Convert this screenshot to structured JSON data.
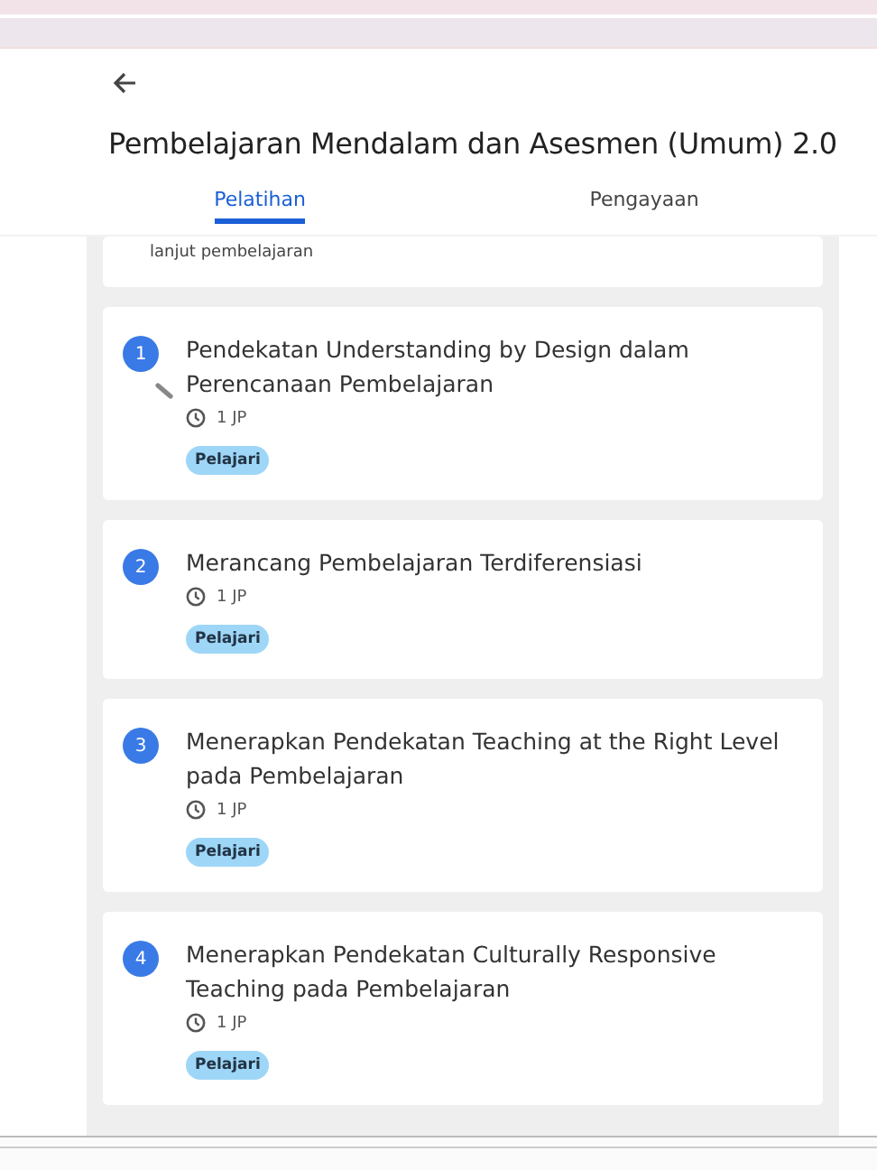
{
  "header": {
    "title": "Pembelajaran Mendalam dan Asesmen (Umum) 2.0"
  },
  "tabs": [
    {
      "label": "Pelatihan",
      "selected": true
    },
    {
      "label": "Pengayaan",
      "selected": false
    }
  ],
  "partial_card": {
    "text": "lanjut pembelajaran"
  },
  "modules": [
    {
      "number": "1",
      "title": "Pendekatan Understanding by Design dalam Perencanaan Pembelajaran",
      "duration": "1 JP",
      "action": "Pelajari",
      "edit_mark": true
    },
    {
      "number": "2",
      "title": "Merancang Pembelajaran Terdiferensiasi",
      "duration": "1 JP",
      "action": "Pelajari",
      "edit_mark": false
    },
    {
      "number": "3",
      "title": "Menerapkan Pendekatan Teaching at the Right Level pada Pembelajaran",
      "duration": "1 JP",
      "action": "Pelajari",
      "edit_mark": false
    },
    {
      "number": "4",
      "title": "Menerapkan Pendekatan Culturally Responsive Teaching pada Pembelajaran",
      "duration": "1 JP",
      "action": "Pelajari",
      "edit_mark": false
    }
  ]
}
